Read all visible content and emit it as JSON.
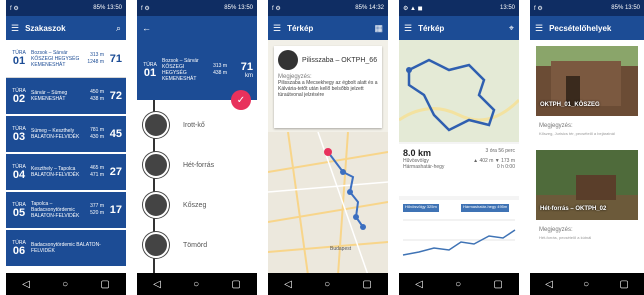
{
  "phones": [
    {
      "status": {
        "left": "f ⚙",
        "right": "85% 13:50"
      },
      "app": {
        "title": "Szakaszok"
      },
      "routes": [
        {
          "tura": "TÚRA",
          "num": "01",
          "name": "Bozsok – Sárvár KŐSZEGI HEGYSÉG KEMENESHÁT",
          "d1": "313 m",
          "d2": "1248 m",
          "big": "71"
        },
        {
          "tura": "TÚRA",
          "num": "02",
          "name": "Sárvár – Sümeg KEMENESHÁT",
          "d1": "450 m",
          "d2": "438 m",
          "big": "72"
        },
        {
          "tura": "TÚRA",
          "num": "03",
          "name": "Sümeg – Keszthely BALATON-FELVIDÉK",
          "d1": "781 m",
          "d2": "430 m",
          "big": "45"
        },
        {
          "tura": "TÚRA",
          "num": "04",
          "name": "Keszthely – Tapolca BALATON-FELVIDÉK",
          "d1": "465 m",
          "d2": "471 m",
          "big": "27"
        },
        {
          "tura": "TÚRA",
          "num": "05",
          "name": "Tapolca – Badacsonytördemic BALATON-FELVIDÉK",
          "d1": "377 m",
          "d2": "520 m",
          "big": "17"
        },
        {
          "tura": "TÚRA",
          "num": "06",
          "name": "Badacsonytördemic BALATON-FELVIDÉK",
          "d1": "",
          "d2": "",
          "big": ""
        }
      ]
    },
    {
      "status": {
        "left": "f ⚙",
        "right": "85% 13:50"
      },
      "app": {
        "title": ""
      },
      "header": {
        "tura": "TÚRA",
        "num": "01",
        "name": "Bozsok – Sárvár KŐSZEGI HEGYSÉG KEMENESHÁT",
        "d1": "313 m",
        "d2": "438 m",
        "big": "71",
        "unit": "km"
      },
      "stops": [
        "Irott-kő",
        "Hét-forrás",
        "Kőszeg",
        "Tömörd"
      ]
    },
    {
      "status": {
        "left": "f ⚙",
        "right": "85% 14:32"
      },
      "app": {
        "title": "Térkép"
      },
      "card": {
        "title": "Pilisszaba – OKTPH_66",
        "label": "Megjegyzés:",
        "text": "Pilisszaba a Mecsekhegy az égbolt alatt és a Kálvária-tetőt után kellő belsőbb jelzett túraútvonal jelzésére"
      },
      "map": {
        "legend": "Budapest"
      }
    },
    {
      "status": {
        "left": "⚙ ▲ ◼",
        "right": "13:50"
      },
      "app": {
        "title": "Térkép"
      },
      "stats": {
        "dist": "8.0 km",
        "time": "3 óra 56 perc",
        "place": "Hűvösvölgy",
        "place2": "Hármashatár-hegy",
        "up": "▲ 402 m  ▼ 173 m",
        "small": "0 h 0:00"
      },
      "elevation": {
        "label_a": "Hűvösvölgy 325m",
        "label_b": "Hármashatár-hegy 495m"
      }
    },
    {
      "status": {
        "left": "f ⚙",
        "right": "85% 13:50"
      },
      "app": {
        "title": "Pecsételőhelyek"
      },
      "items": [
        {
          "caption": "OKTPH_01_KÖSZEG",
          "label": "Megjegyzés:",
          "text": "Kőszeg, Jurisics tér, pecsételő a bejáratnál"
        },
        {
          "caption": "Hét-forrás – OKTPH_02",
          "label": "Megjegyzés:",
          "text": "Hét-forrás, pecsételő a kútnál"
        }
      ]
    }
  ],
  "nav": {
    "back": "◁",
    "home": "○",
    "recent": "▢"
  },
  "colors": {
    "primary": "#1c4c95",
    "statusbar": "#0f2d63",
    "accent": "#e8315c"
  }
}
